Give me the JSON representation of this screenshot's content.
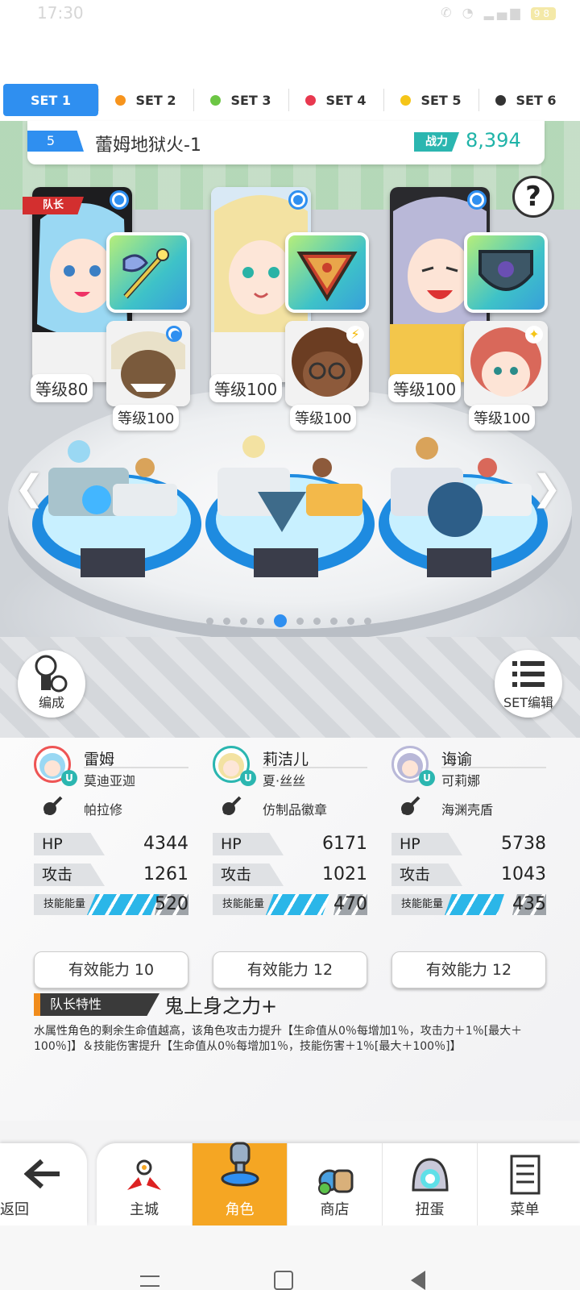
{
  "status_bar": {
    "time": "17:30",
    "battery": "98"
  },
  "set_tabs": [
    {
      "label": "SET 1",
      "color": "",
      "active": true
    },
    {
      "label": "SET 2",
      "color": "#f7941d"
    },
    {
      "label": "SET 3",
      "color": "#6cc644"
    },
    {
      "label": "SET 4",
      "color": "#e8384f"
    },
    {
      "label": "SET 5",
      "color": "#f5c518"
    },
    {
      "label": "SET 6",
      "color": "#333333"
    }
  ],
  "team": {
    "number": "5",
    "name": "蕾姆地狱火-1",
    "power_label": "战力",
    "power_value": "8,394"
  },
  "leader_badge": "队长",
  "help_icon": "?",
  "heroes": [
    {
      "level": "等级80",
      "support_level": "等级100",
      "name": "雷姆",
      "skin": "莫迪亚迦",
      "weapon": "帕拉修",
      "hp_label": "HP",
      "hp": "4344",
      "atk_label": "攻击",
      "atk": "1261",
      "energy_label": "技能能量",
      "energy": "520",
      "effective": "有效能力 10"
    },
    {
      "level": "等级100",
      "support_level": "等级100",
      "name": "莉洁儿",
      "skin": "夏·丝丝",
      "weapon": "仿制品徽章",
      "hp_label": "HP",
      "hp": "6171",
      "atk_label": "攻击",
      "atk": "1021",
      "energy_label": "技能能量",
      "energy": "470",
      "effective": "有效能力 12"
    },
    {
      "level": "等级100",
      "support_level": "等级100",
      "name": "诲谕",
      "skin": "可莉娜",
      "weapon": "海渊壳盾",
      "hp_label": "HP",
      "hp": "5738",
      "atk_label": "攻击",
      "atk": "1043",
      "energy_label": "技能能量",
      "energy": "435",
      "effective": "有效能力 12"
    }
  ],
  "page_dots": {
    "count": 10,
    "active_index": 4
  },
  "buttons": {
    "formation": "编成",
    "set_edit": "SET编辑"
  },
  "leader_skill": {
    "label": "队长特性",
    "name": "鬼上身之力+",
    "description": "水属性角色的剩余生命值越高，该角色攻击力提升【生命值从0％每增加1％，攻击力＋1％[最大＋100％]】＆技能伤害提升【生命值从0％每增加1％，技能伤害＋1％[最大＋100％]】"
  },
  "bottom_nav": {
    "back": "返回",
    "items": [
      {
        "label": "主城",
        "icon": "castle-icon"
      },
      {
        "label": "角色",
        "icon": "hero-icon",
        "active": true
      },
      {
        "label": "商店",
        "icon": "shop-icon"
      },
      {
        "label": "扭蛋",
        "icon": "gacha-icon"
      },
      {
        "label": "菜单",
        "icon": "menu-icon"
      }
    ]
  }
}
